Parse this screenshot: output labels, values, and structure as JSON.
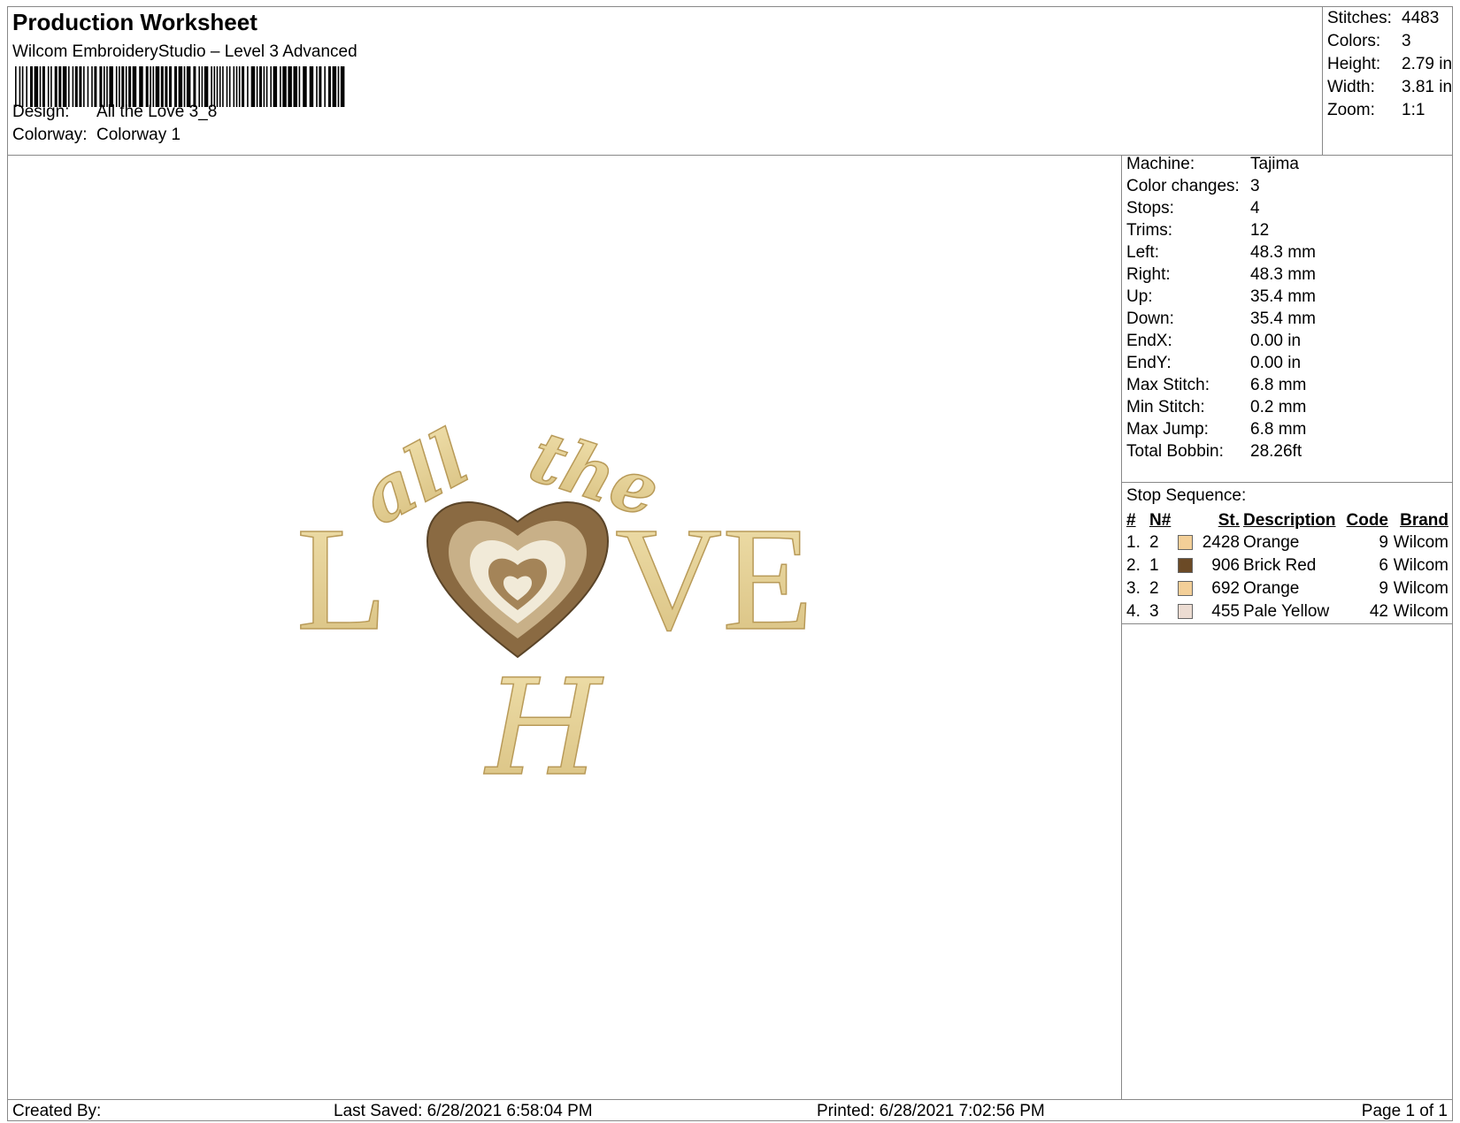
{
  "header": {
    "title": "Production Worksheet",
    "subtitle": "Wilcom EmbroideryStudio – Level 3 Advanced",
    "design_label": "Design:",
    "design_value": "All the Love 3_8",
    "colorway_label": "Colorway:",
    "colorway_value": "Colorway 1"
  },
  "stats": [
    {
      "label": "Stitches:",
      "value": "4483"
    },
    {
      "label": "Colors:",
      "value": "3"
    },
    {
      "label": "Height:",
      "value": "2.79 in"
    },
    {
      "label": "Width:",
      "value": "3.81 in"
    },
    {
      "label": "Zoom:",
      "value": "1:1"
    }
  ],
  "machine_info": [
    {
      "label": "Machine:",
      "value": "Tajima"
    },
    {
      "label": "Color changes:",
      "value": "3"
    },
    {
      "label": "Stops:",
      "value": "4"
    },
    {
      "label": "Trims:",
      "value": "12"
    },
    {
      "label": "Left:",
      "value": "48.3 mm"
    },
    {
      "label": "Right:",
      "value": "48.3 mm"
    },
    {
      "label": "Up:",
      "value": "35.4 mm"
    },
    {
      "label": "Down:",
      "value": "35.4 mm"
    },
    {
      "label": "EndX:",
      "value": "0.00 in"
    },
    {
      "label": "EndY:",
      "value": "0.00 in"
    },
    {
      "label": "Max Stitch:",
      "value": "6.8 mm"
    },
    {
      "label": "Min Stitch:",
      "value": "0.2 mm"
    },
    {
      "label": "Max Jump:",
      "value": "6.8 mm"
    },
    {
      "label": "Total Bobbin:",
      "value": "28.26ft"
    }
  ],
  "stop_sequence": {
    "title": "Stop Sequence:",
    "headers": {
      "idx": "#",
      "n": "N#",
      "st": "St.",
      "desc": "Description",
      "code": "Code",
      "brand": "Brand"
    },
    "rows": [
      {
        "idx": "1.",
        "n": "2",
        "color": "#f3cf98",
        "st": "2428",
        "desc": "Orange",
        "code": "9",
        "brand": "Wilcom"
      },
      {
        "idx": "2.",
        "n": "1",
        "color": "#6b4a26",
        "st": "906",
        "desc": "Brick Red",
        "code": "6",
        "brand": "Wilcom"
      },
      {
        "idx": "3.",
        "n": "2",
        "color": "#f3cf98",
        "st": "692",
        "desc": "Orange",
        "code": "9",
        "brand": "Wilcom"
      },
      {
        "idx": "4.",
        "n": "3",
        "color": "#ecdcd2",
        "st": "455",
        "desc": "Pale Yellow",
        "code": "42",
        "brand": "Wilcom"
      }
    ]
  },
  "design": {
    "word_top_left": "all",
    "word_top_right": "the",
    "letter_l": "L",
    "letters_ve": "VE",
    "monogram": "H",
    "thread_gold": "#e8d49a",
    "thread_brown": "#8a6a42",
    "thread_cream": "#f1ead8"
  },
  "footer": {
    "created_by": "Created By:",
    "last_saved": "Last Saved: 6/28/2021 6:58:04 PM",
    "printed": "Printed: 6/28/2021 7:02:56 PM",
    "page": "Page 1 of 1"
  }
}
